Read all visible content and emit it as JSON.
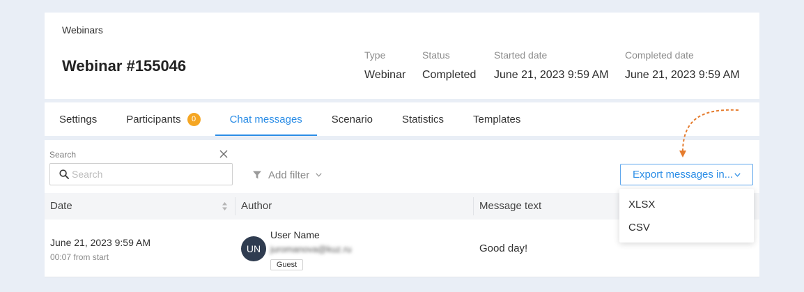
{
  "header": {
    "breadcrumb": "Webinars",
    "title": "Webinar #155046",
    "meta": [
      {
        "label": "Type",
        "value": "Webinar"
      },
      {
        "label": "Status",
        "value": "Completed"
      },
      {
        "label": "Started date",
        "value": "June 21, 2023 9:59 AM"
      },
      {
        "label": "Completed date",
        "value": "June 21, 2023 9:59 AM"
      }
    ]
  },
  "tabs": [
    {
      "label": "Settings",
      "active": false
    },
    {
      "label": "Participants",
      "badge": "0",
      "active": false
    },
    {
      "label": "Chat messages",
      "active": true
    },
    {
      "label": "Scenario",
      "active": false
    },
    {
      "label": "Statistics",
      "active": false
    },
    {
      "label": "Templates",
      "active": false
    }
  ],
  "toolbar": {
    "search_label": "Search",
    "search_placeholder": "Search",
    "add_filter_label": "Add filter",
    "export_label": "Export messages in...",
    "export_menu_open": true,
    "export_options": [
      "XLSX",
      "CSV"
    ]
  },
  "table": {
    "columns": [
      "Date",
      "Author",
      "Message text"
    ],
    "rows": [
      {
        "date": "June 21, 2023 9:59 AM",
        "offset": "00:07 from start",
        "author": {
          "initials": "UN",
          "name": "User Name",
          "email": "juromanova@kuz.ru",
          "role": "Guest"
        },
        "message": "Good day!"
      }
    ]
  },
  "icons": {
    "search": "search-icon",
    "clear": "close-icon",
    "filter": "funnel-icon",
    "dropdown": "chevron-down-icon",
    "sort": "sort-icon"
  },
  "colors": {
    "background": "#e9eef6",
    "accent": "#2b8de6",
    "badge": "#f5a623",
    "avatar": "#2f3c50",
    "annotation": "#e57c2e"
  }
}
